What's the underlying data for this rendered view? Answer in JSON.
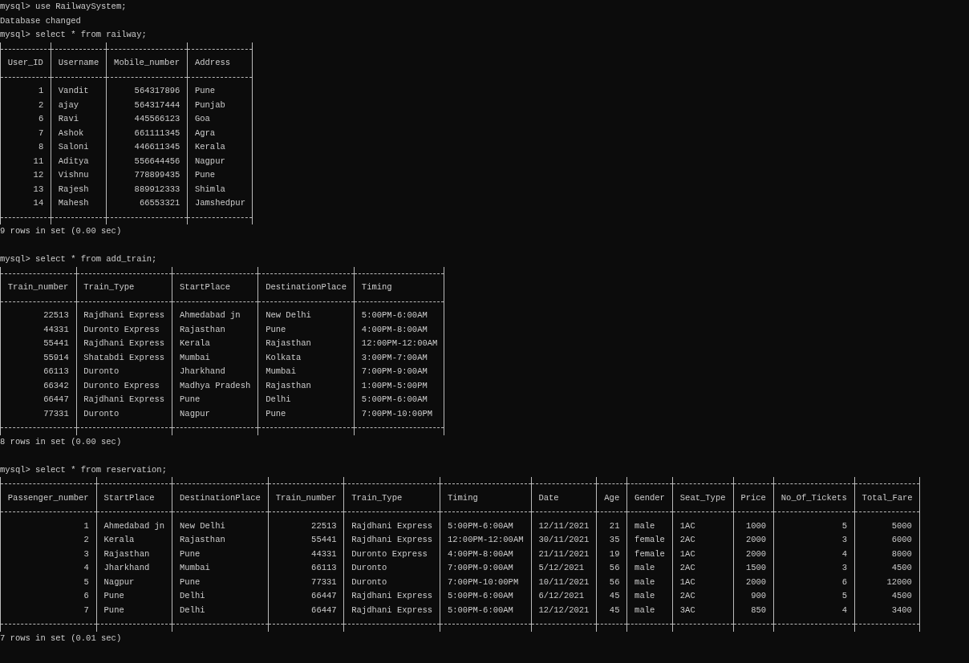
{
  "terminal": [
    {
      "kind": "command",
      "text": "mysql> use RailwaySystem;"
    },
    {
      "kind": "output",
      "text": "Database changed"
    },
    {
      "kind": "command",
      "text": "mysql> select * from railway;"
    },
    {
      "kind": "table",
      "columns": [
        {
          "name": "User_ID",
          "kind": "number"
        },
        {
          "name": "Username",
          "kind": "text"
        },
        {
          "name": "Mobile_number",
          "kind": "number"
        },
        {
          "name": "Address",
          "kind": "text"
        }
      ],
      "rows": [
        [
          "1",
          "Vandit",
          "564317896",
          "Pune"
        ],
        [
          "2",
          "ajay",
          "564317444",
          "Punjab"
        ],
        [
          "6",
          "Ravi",
          "445566123",
          "Goa"
        ],
        [
          "7",
          "Ashok",
          "661111345",
          "Agra"
        ],
        [
          "8",
          "Saloni",
          "446611345",
          "Kerala"
        ],
        [
          "11",
          "Aditya",
          "556644456",
          "Nagpur"
        ],
        [
          "12",
          "Vishnu",
          "778899435",
          "Pune"
        ],
        [
          "13",
          "Rajesh",
          "889912333",
          "Shimla"
        ],
        [
          "14",
          "Mahesh",
          "66553321",
          "Jamshedpur"
        ]
      ]
    },
    {
      "kind": "status",
      "text": "9 rows in set (0.00 sec)"
    },
    {
      "kind": "command",
      "text": "mysql> select * from add_train;"
    },
    {
      "kind": "table",
      "columns": [
        {
          "name": "Train_number",
          "kind": "number"
        },
        {
          "name": "Train_Type",
          "kind": "text"
        },
        {
          "name": "StartPlace",
          "kind": "text"
        },
        {
          "name": "DestinationPlace",
          "kind": "text"
        },
        {
          "name": "Timing",
          "kind": "text"
        }
      ],
      "rows": [
        [
          "22513",
          "Rajdhani Express",
          "Ahmedabad jn",
          "New Delhi",
          "5:00PM-6:00AM"
        ],
        [
          "44331",
          "Duronto Express",
          "Rajasthan",
          "Pune",
          "4:00PM-8:00AM"
        ],
        [
          "55441",
          "Rajdhani Express",
          "Kerala",
          "Rajasthan",
          "12:00PM-12:00AM"
        ],
        [
          "55914",
          "Shatabdi Express",
          "Mumbai",
          "Kolkata",
          "3:00PM-7:00AM"
        ],
        [
          "66113",
          "Duronto",
          "Jharkhand",
          "Mumbai",
          "7:00PM-9:00AM"
        ],
        [
          "66342",
          "Duronto Express",
          "Madhya Pradesh",
          "Rajasthan",
          "1:00PM-5:00PM"
        ],
        [
          "66447",
          "Rajdhani Express",
          "Pune",
          "Delhi",
          "5:00PM-6:00AM"
        ],
        [
          "77331",
          "Duronto",
          "Nagpur",
          "Pune",
          "7:00PM-10:00PM"
        ]
      ]
    },
    {
      "kind": "status",
      "text": "8 rows in set (0.00 sec)"
    },
    {
      "kind": "command",
      "text": "mysql> select * from reservation;"
    },
    {
      "kind": "table",
      "columns": [
        {
          "name": "Passenger_number",
          "kind": "number"
        },
        {
          "name": "StartPlace",
          "kind": "text"
        },
        {
          "name": "DestinationPlace",
          "kind": "text"
        },
        {
          "name": "Train_number",
          "kind": "number"
        },
        {
          "name": "Train_Type",
          "kind": "text"
        },
        {
          "name": "Timing",
          "kind": "text"
        },
        {
          "name": "Date",
          "kind": "text"
        },
        {
          "name": "Age",
          "kind": "number"
        },
        {
          "name": "Gender",
          "kind": "text"
        },
        {
          "name": "Seat_Type",
          "kind": "text"
        },
        {
          "name": "Price",
          "kind": "number"
        },
        {
          "name": "No_Of_Tickets",
          "kind": "number"
        },
        {
          "name": "Total_Fare",
          "kind": "number"
        }
      ],
      "rows": [
        [
          "1",
          "Ahmedabad jn",
          "New Delhi",
          "22513",
          "Rajdhani Express",
          "5:00PM-6:00AM",
          "12/11/2021",
          "21",
          "male",
          "1AC",
          "1000",
          "5",
          "5000"
        ],
        [
          "2",
          "Kerala",
          "Rajasthan",
          "55441",
          "Rajdhani Express",
          "12:00PM-12:00AM",
          "30/11/2021",
          "35",
          "female",
          "2AC",
          "2000",
          "3",
          "6000"
        ],
        [
          "3",
          "Rajasthan",
          "Pune",
          "44331",
          "Duronto Express",
          "4:00PM-8:00AM",
          "21/11/2021",
          "19",
          "female",
          "1AC",
          "2000",
          "4",
          "8000"
        ],
        [
          "4",
          "Jharkhand",
          "Mumbai",
          "66113",
          "Duronto",
          "7:00PM-9:00AM",
          "5/12/2021",
          "56",
          "male",
          "2AC",
          "1500",
          "3",
          "4500"
        ],
        [
          "5",
          "Nagpur",
          "Pune",
          "77331",
          "Duronto",
          "7:00PM-10:00PM",
          "10/11/2021",
          "56",
          "male",
          "1AC",
          "2000",
          "6",
          "12000"
        ],
        [
          "6",
          "Pune",
          "Delhi",
          "66447",
          "Rajdhani Express",
          "5:00PM-6:00AM",
          "6/12/2021",
          "45",
          "male",
          "2AC",
          "900",
          "5",
          "4500"
        ],
        [
          "7",
          "Pune",
          "Delhi",
          "66447",
          "Rajdhani Express",
          "5:00PM-6:00AM",
          "12/12/2021",
          "45",
          "male",
          "3AC",
          "850",
          "4",
          "3400"
        ]
      ]
    },
    {
      "kind": "status",
      "text": "7 rows in set (0.01 sec)"
    }
  ]
}
